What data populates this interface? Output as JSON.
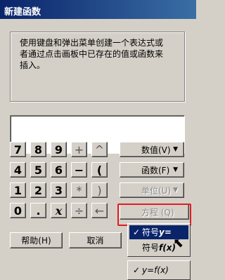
{
  "window": {
    "title": "新建函数"
  },
  "description": "使用键盘和弹出菜单创建一个表达式或者通过点击画板中已存在的值或函数来插入。",
  "expression": {
    "value": ""
  },
  "keypad": {
    "row1": [
      "7",
      "8",
      "9",
      "+",
      "^"
    ],
    "row2": [
      "4",
      "5",
      "6",
      "−",
      "("
    ],
    "row3": [
      "1",
      "2",
      "3",
      "*",
      ")"
    ],
    "row4": [
      "0",
      ".",
      "x",
      "÷",
      "←"
    ]
  },
  "side_buttons": {
    "numbers": "数值(V)",
    "functions": "函数(F)",
    "units": "单位(U)",
    "equation": "方程 (Q)"
  },
  "bottom_buttons": {
    "help": "帮助(H)",
    "cancel": "取消"
  },
  "equation_menu": {
    "item1": {
      "prefix": "符号",
      "symbol": "y="
    },
    "item2": {
      "prefix": "符号",
      "symbol": "f(x)"
    },
    "item3": {
      "symbol": "y=f(x)"
    }
  },
  "check_mark": "✓"
}
